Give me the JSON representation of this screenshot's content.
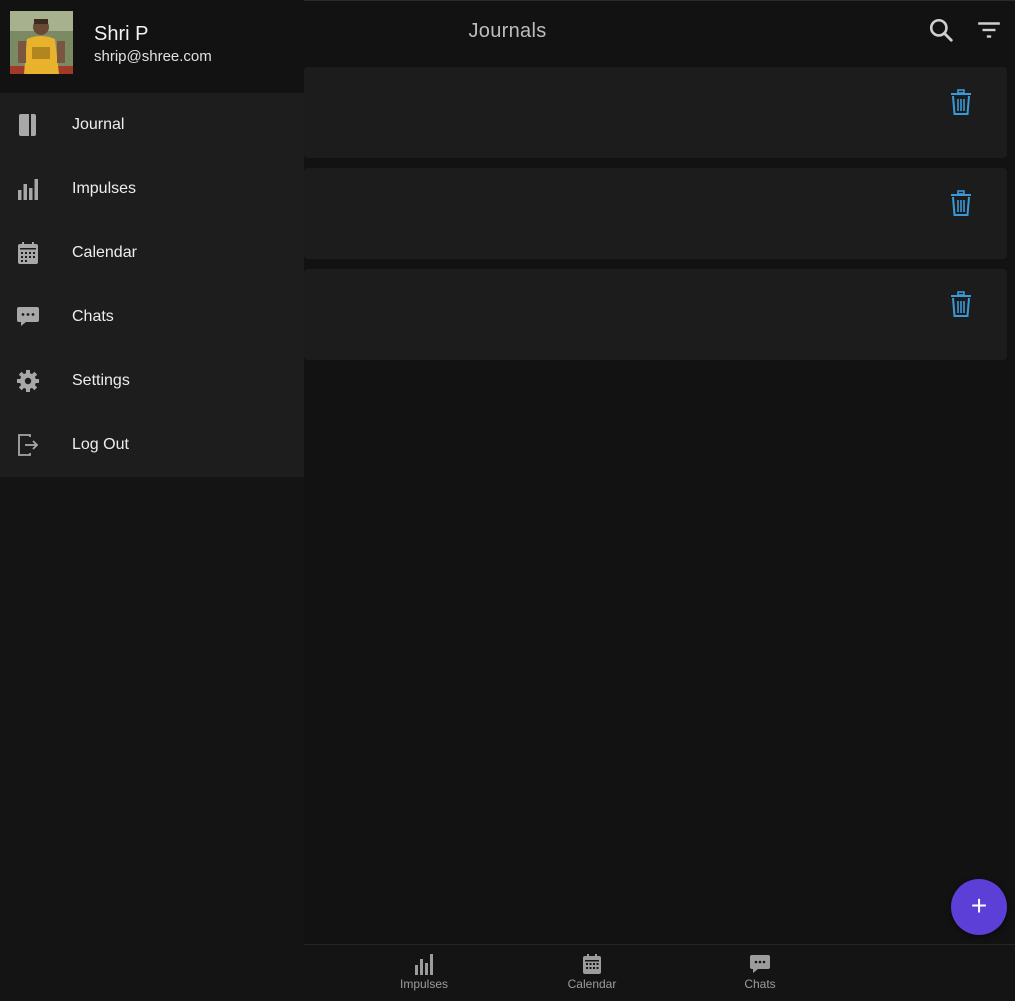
{
  "header": {
    "title": "Journals"
  },
  "user": {
    "name": "Shri P",
    "email": "shrip@shree.com"
  },
  "menu": {
    "items": [
      {
        "label": "Journal",
        "icon": "journal-icon"
      },
      {
        "label": "Impulses",
        "icon": "bar-chart-icon"
      },
      {
        "label": "Calendar",
        "icon": "calendar-icon"
      },
      {
        "label": "Chats",
        "icon": "chat-icon"
      },
      {
        "label": "Settings",
        "icon": "gear-icon"
      },
      {
        "label": "Log Out",
        "icon": "logout-icon"
      }
    ]
  },
  "bottom_nav": {
    "items": [
      {
        "label": "Impulses",
        "icon": "bar-chart-icon"
      },
      {
        "label": "Calendar",
        "icon": "calendar-icon"
      },
      {
        "label": "Chats",
        "icon": "chat-icon"
      }
    ]
  },
  "colors": {
    "accent": "#5b3fd6",
    "delete": "#3a9ad9",
    "background": "#121212"
  }
}
